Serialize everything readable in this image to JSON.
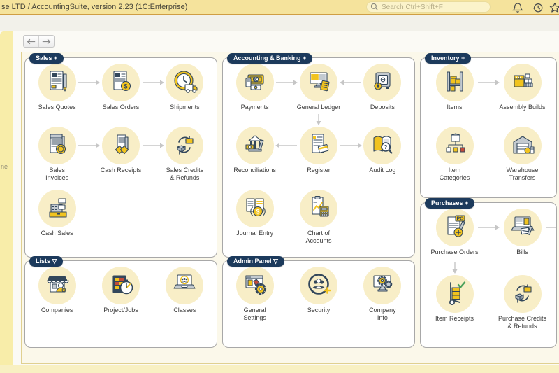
{
  "titlebar": {
    "title": "se LTD / AccountingSuite, version 2.23  (1C:Enterprise)",
    "search_placeholder": "Search Ctrl+Shift+F",
    "icons": [
      "bell-icon",
      "history-icon",
      "star-icon"
    ]
  },
  "sidebar": {
    "fragment_text": "ne"
  },
  "colors": {
    "badge_bg": "#1c3a5c",
    "accent_yellow": "#f1c31f",
    "titlebar_bg": "#f5e39c",
    "icon_circle_bg": "#f8eec7",
    "arrow_grey": "#c6c6c6"
  },
  "panels": [
    {
      "id": "sales",
      "badge": "Sales +",
      "cols": 3,
      "rows": [
        {
          "cells": [
            {
              "label": "Sales Quotes",
              "icon": "document-pencil-icon"
            },
            {
              "label": "Sales Orders",
              "icon": "document-dollar-icon"
            },
            {
              "label": "Shipments",
              "icon": "clock-truck-icon"
            }
          ],
          "arrows": [
            {
              "after": 0,
              "dir": "right"
            },
            {
              "after": 1,
              "dir": "right"
            }
          ]
        },
        {
          "cells": [
            {
              "label": "Sales\nInvoices",
              "icon": "invoice-coin-icon"
            },
            {
              "label": "Cash Receipts",
              "icon": "receipts-coins-icon"
            },
            {
              "label": "Sales Credits\n& Refunds",
              "icon": "refund-cycle-icon"
            }
          ],
          "arrows": [
            {
              "after": 0,
              "dir": "right"
            },
            {
              "after": 1,
              "dir": "right"
            }
          ]
        },
        {
          "cells": [
            {
              "label": "Cash Sales",
              "icon": "cash-register-icon"
            },
            null,
            null
          ],
          "arrows": []
        }
      ],
      "varrows": []
    },
    {
      "id": "accounting",
      "badge": "Accounting & Banking +",
      "cols": 3,
      "rows": [
        {
          "cells": [
            {
              "label": "Payments",
              "icon": "money-stack-icon"
            },
            {
              "label": "General Ledger",
              "icon": "monitor-ledger-icon"
            },
            {
              "label": "Deposits",
              "icon": "safe-icon"
            }
          ],
          "arrows": [
            {
              "after": 0,
              "dir": "right"
            },
            {
              "after": 1,
              "dir": "left"
            }
          ]
        },
        {
          "cells": [
            {
              "label": "Reconciliations",
              "icon": "bank-money-icon"
            },
            {
              "label": "Register",
              "icon": "register-doc-icon"
            },
            {
              "label": "Audit Log",
              "icon": "book-magnifier-icon"
            }
          ],
          "arrows": [
            {
              "after": 0,
              "dir": "left"
            },
            {
              "after": 1,
              "dir": "right"
            }
          ]
        },
        {
          "cells": [
            {
              "label": "Journal Entry",
              "icon": "book-coin-icon"
            },
            {
              "label": "Chart of\nAccounts",
              "icon": "chart-calculator-icon"
            },
            null
          ],
          "arrows": []
        }
      ],
      "varrows": [
        {
          "afterRow": 0,
          "col": 1
        }
      ]
    },
    {
      "id": "inventory",
      "badge": "Inventory +",
      "cols": 2,
      "rows": [
        {
          "cells": [
            {
              "label": "Items",
              "icon": "shelf-boxes-icon"
            },
            {
              "label": "Assembly Builds",
              "icon": "assembly-boxes-icon"
            }
          ],
          "arrows": [
            {
              "after": 0,
              "dir": "right"
            }
          ]
        },
        {
          "cells": [
            {
              "label": "Item\nCategories",
              "icon": "category-tree-icon"
            },
            {
              "label": "Warehouse\nTransfers",
              "icon": "warehouse-icon"
            }
          ],
          "arrows": []
        }
      ],
      "varrows": []
    },
    {
      "id": "purchases",
      "badge": "Purchases +",
      "cols": 2,
      "rows": [
        {
          "cells": [
            {
              "label": "Purchase Orders",
              "icon": "po-document-icon"
            },
            {
              "label": "Bills",
              "icon": "laptop-bill-icon"
            }
          ],
          "arrows": [
            {
              "after": 0,
              "dir": "right"
            },
            {
              "after": 1,
              "dir": "right"
            }
          ]
        },
        {
          "cells": [
            {
              "label": "Item Receipts",
              "icon": "handtruck-icon"
            },
            {
              "label": "Purchase Credits\n& Refunds",
              "icon": "refund-cycle-icon"
            }
          ],
          "arrows": []
        }
      ],
      "varrows": [
        {
          "afterRow": 0,
          "col": 0
        }
      ]
    },
    {
      "id": "lists",
      "badge": "Lists ▽",
      "cols": 3,
      "rows": [
        {
          "cells": [
            {
              "label": "Companies",
              "icon": "storefront-icon"
            },
            {
              "label": "Project/Jobs",
              "icon": "tasks-stopwatch-icon"
            },
            {
              "label": "Classes",
              "icon": "laptop-people-icon"
            }
          ],
          "arrows": []
        }
      ],
      "varrows": []
    },
    {
      "id": "admin",
      "badge": "Admin Panel ▽",
      "cols": 3,
      "rows": [
        {
          "cells": [
            {
              "label": "General\nSettings",
              "icon": "window-gear-icon"
            },
            {
              "label": "Security",
              "icon": "people-circle-icon"
            },
            {
              "label": "Company\nInfo",
              "icon": "monitor-gear-icon"
            }
          ],
          "arrows": []
        }
      ],
      "varrows": []
    }
  ]
}
